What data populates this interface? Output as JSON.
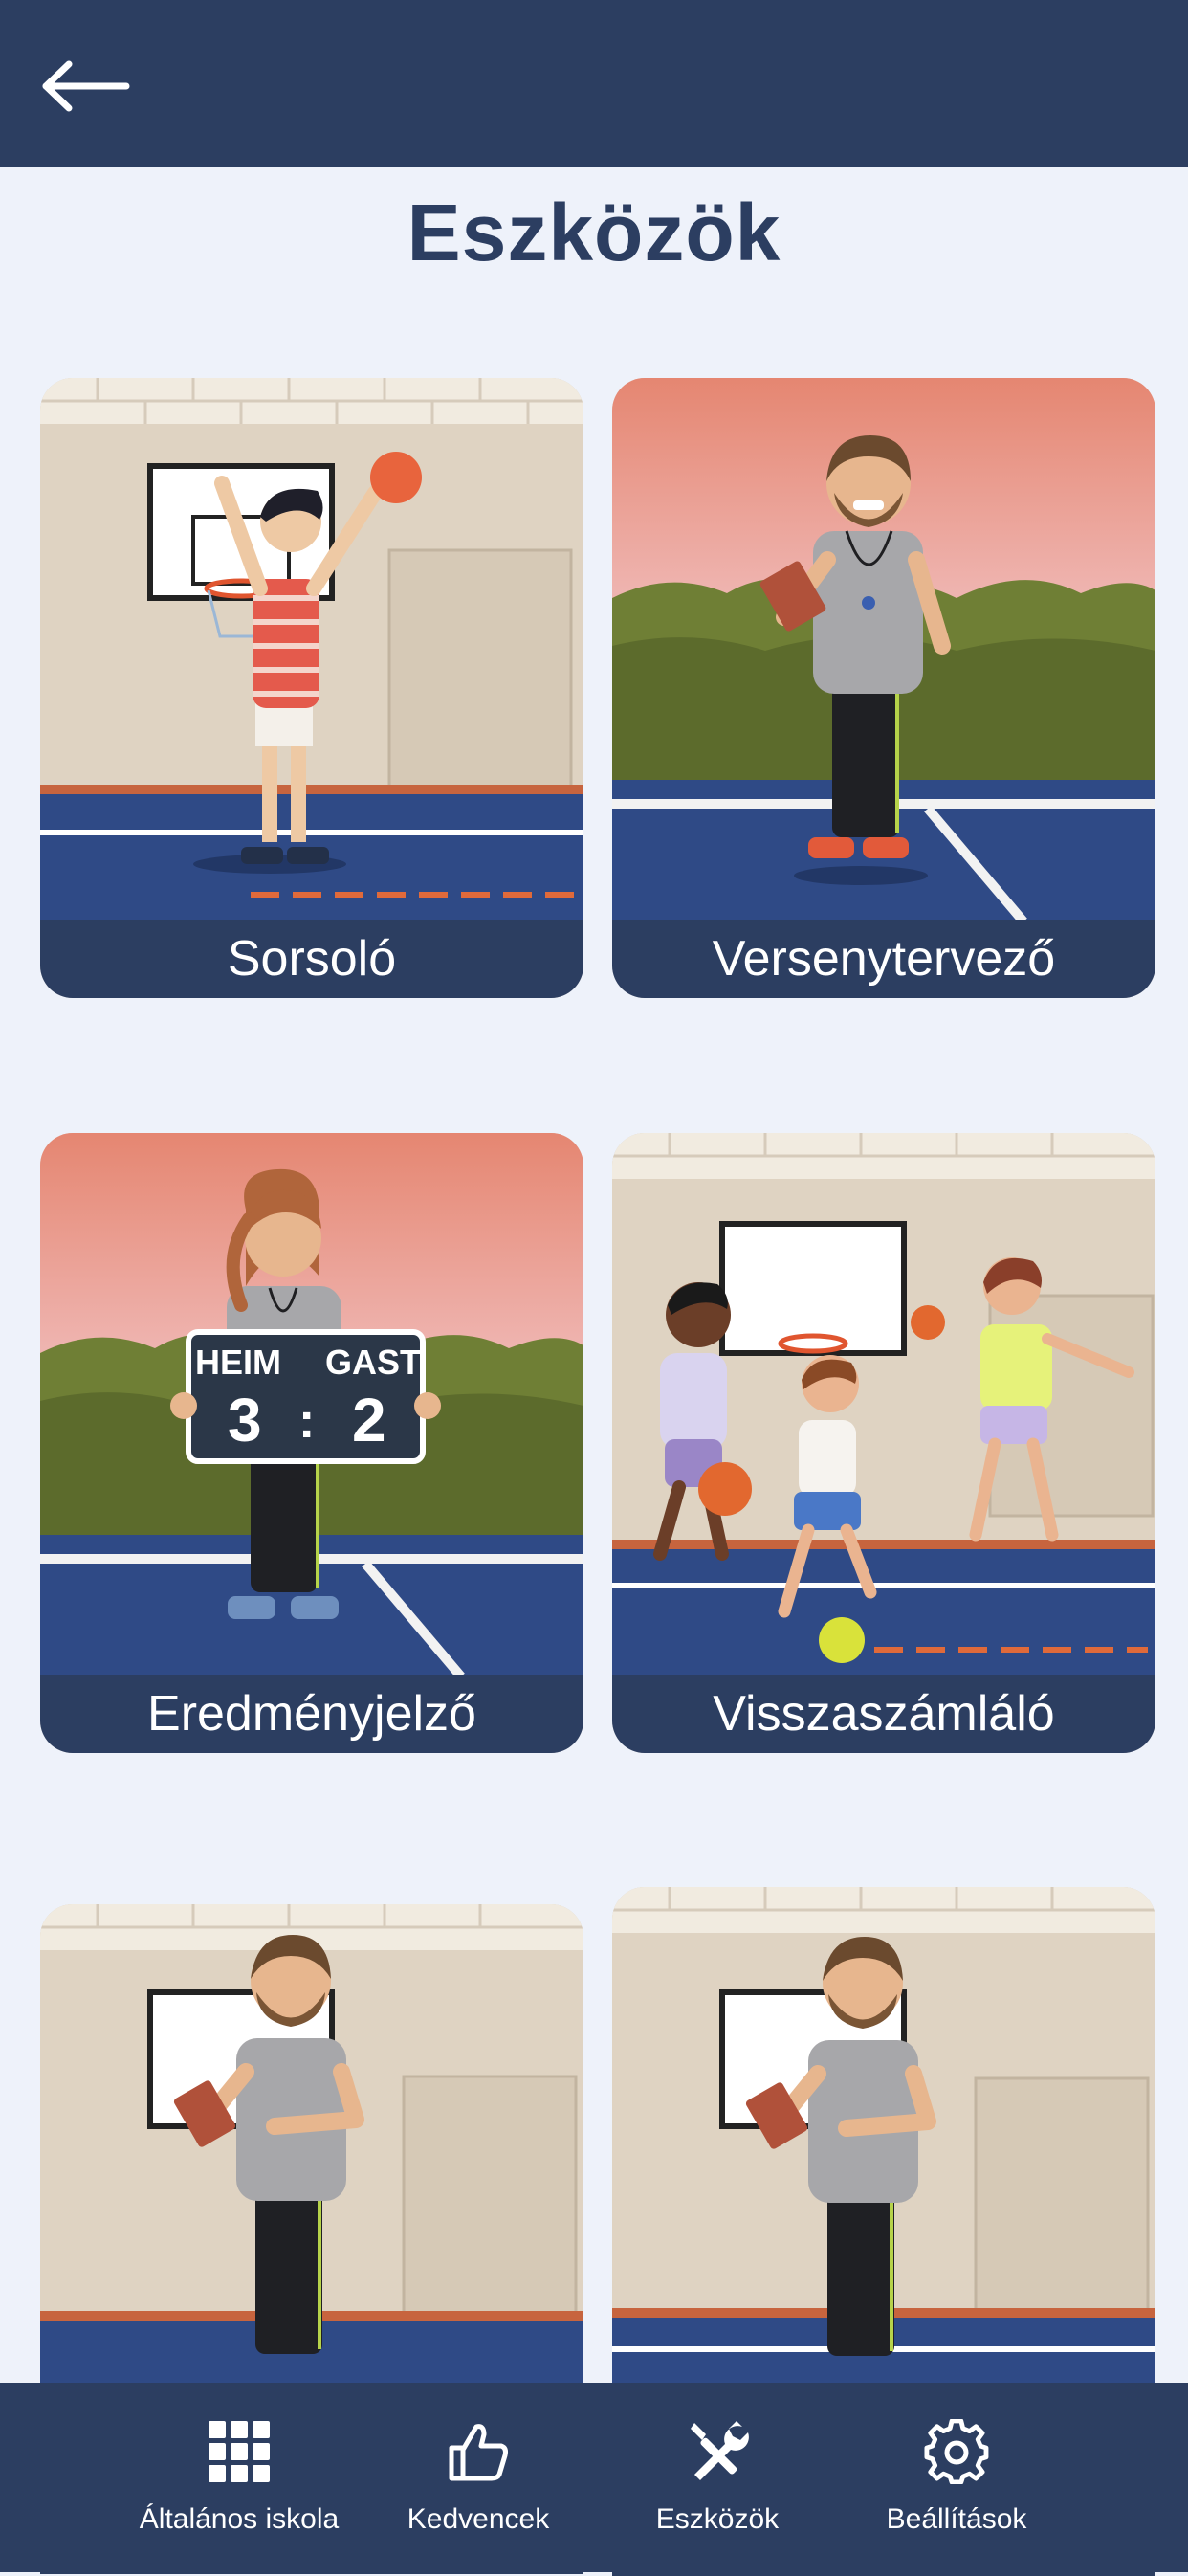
{
  "header": {
    "back_icon": "arrow-left-icon"
  },
  "page_title": "Eszközök",
  "tools": [
    {
      "label": "Sorsoló"
    },
    {
      "label": "Versenytervező"
    },
    {
      "label": "Eredményjelző",
      "scoreboard": {
        "home": "HEIM",
        "away": "GAST",
        "home_score": "3",
        "separator": ":",
        "away_score": "2"
      }
    },
    {
      "label": "Visszaszámláló"
    },
    {
      "label": ""
    },
    {
      "label": ""
    }
  ],
  "bottom_nav": [
    {
      "label": "Általános iskola",
      "icon": "grid-icon"
    },
    {
      "label": "Kedvencek",
      "icon": "thumbs-up-icon"
    },
    {
      "label": "Eszközök",
      "icon": "tools-icon"
    },
    {
      "label": "Beállítások",
      "icon": "gear-icon"
    }
  ],
  "colors": {
    "primary": "#2c3e61",
    "background": "#eef2fa",
    "court": "#2f4a86"
  }
}
